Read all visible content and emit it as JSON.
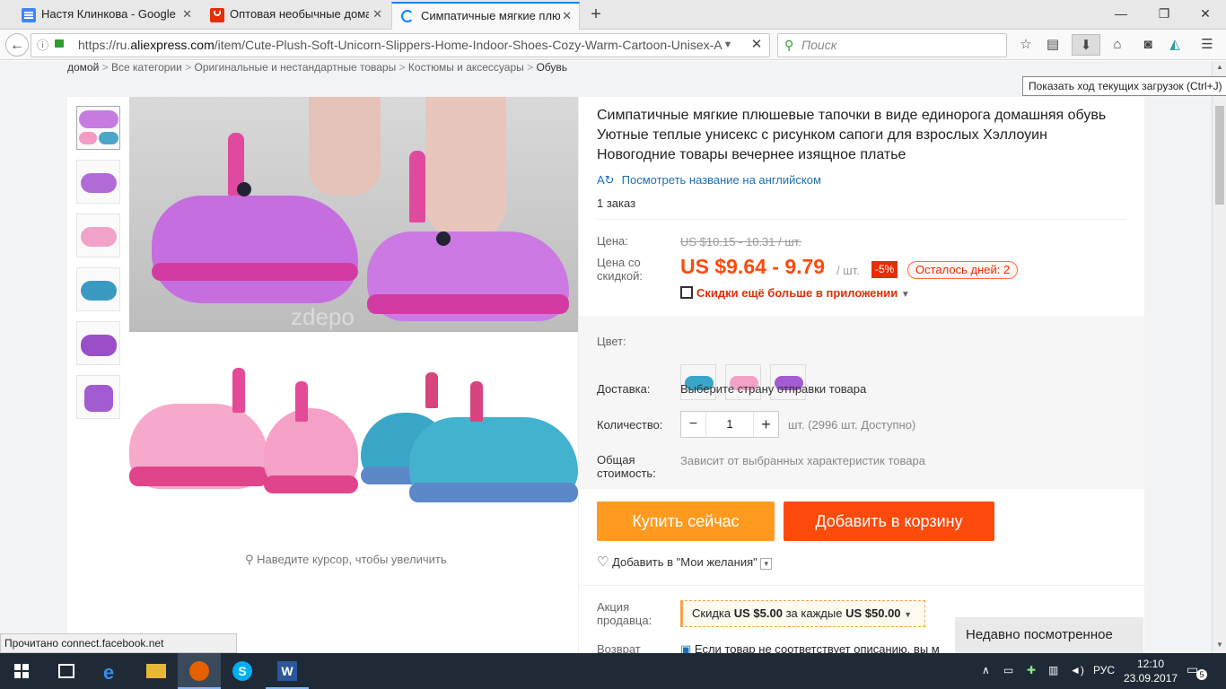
{
  "tabs": [
    {
      "label": "Настя Клинкова - Google Д",
      "icon": "google-docs-icon",
      "color": "#4285f4"
    },
    {
      "label": "Оптовая необычные домаш",
      "icon": "aliexpress-icon",
      "color": "#e62e04"
    },
    {
      "label": "Симпатичные мягкие плюш",
      "icon": "loading-icon",
      "color": "#0a84ff"
    }
  ],
  "window": {
    "minimize": "—",
    "restore": "❐",
    "close": "✕"
  },
  "nav": {
    "url_prefix": "https://ru.",
    "url_domain": "aliexpress.com",
    "url_rest": "/item/Cute-Plush-Soft-Unicorn-Slippers-Home-Indoor-Shoes-Cozy-Warm-Cartoon-Unisex-A",
    "search_placeholder": "Поиск"
  },
  "tooltip": "Показать ход текущих загрузок (Ctrl+J)",
  "breadcrumb": [
    "домой",
    "Все категории",
    "Оригинальные и нестандартные товары",
    "Костюмы и аксессуары",
    "Обувь"
  ],
  "product": {
    "title": "Симпатичные мягкие плюшевые тапочки в виде единорога домашняя обувь Уютные теплые унисекс с рисунком сапоги для взрослых Хэллоуин Новогодние товары вечернее изящное платье",
    "translate_link": "Посмотреть название на английском",
    "orders": "1 заказ",
    "price_label": "Цена:",
    "old_price": "US $10.15 - 10.31 / шт.",
    "discount_label_1": "Цена со",
    "discount_label_2": "скидкой:",
    "price": "US $9.64 - 9.79",
    "price_unit": "/ шт.",
    "discount_badge": "-5%",
    "days_left": "Осталось дней: 2",
    "app_discount": "Скидки ещё больше в приложении",
    "color_label": "Цвет:",
    "delivery_label": "Доставка:",
    "delivery_value": "Выберите страну отправки товара",
    "qty_label": "Количество:",
    "qty_value": "1",
    "qty_minus": "−",
    "qty_plus": "+",
    "qty_available": "шт. (2996 шт. Доступно)",
    "total_label_1": "Общая",
    "total_label_2": "стоимость:",
    "total_value": "Зависит от выбранных характеристик товара",
    "buy_now": "Купить сейчас",
    "add_cart": "Добавить в корзину",
    "wishlist": "Добавить в \"Мои желания\"",
    "promo_label_1": "Акция",
    "promo_label_2": "продавца:",
    "promo_text_1": "Скидка",
    "promo_amount_1": "US $5.00",
    "promo_text_2": "за каждые",
    "promo_amount_2": "US $50.00",
    "return_label": "Возврат",
    "return_text": "Если товар не соответствует описанию, вы м",
    "zoom_hint": "Наведите курсор, чтобы увеличить",
    "watermark": "zdepo"
  },
  "recent": "Недавно посмотренное",
  "status": "Прочитано connect.facebook.net",
  "taskbar": {
    "lang": "РУС",
    "time": "12:10",
    "date": "23.09.2017",
    "notif_count": "5"
  },
  "colors": {
    "accent": "#ff4a0d",
    "buy": "#ff9a1f",
    "price": "#ff4a0d",
    "link": "#1c6fb7",
    "tab_active": "#0a84ff",
    "taskbar": "#1f2a36"
  }
}
